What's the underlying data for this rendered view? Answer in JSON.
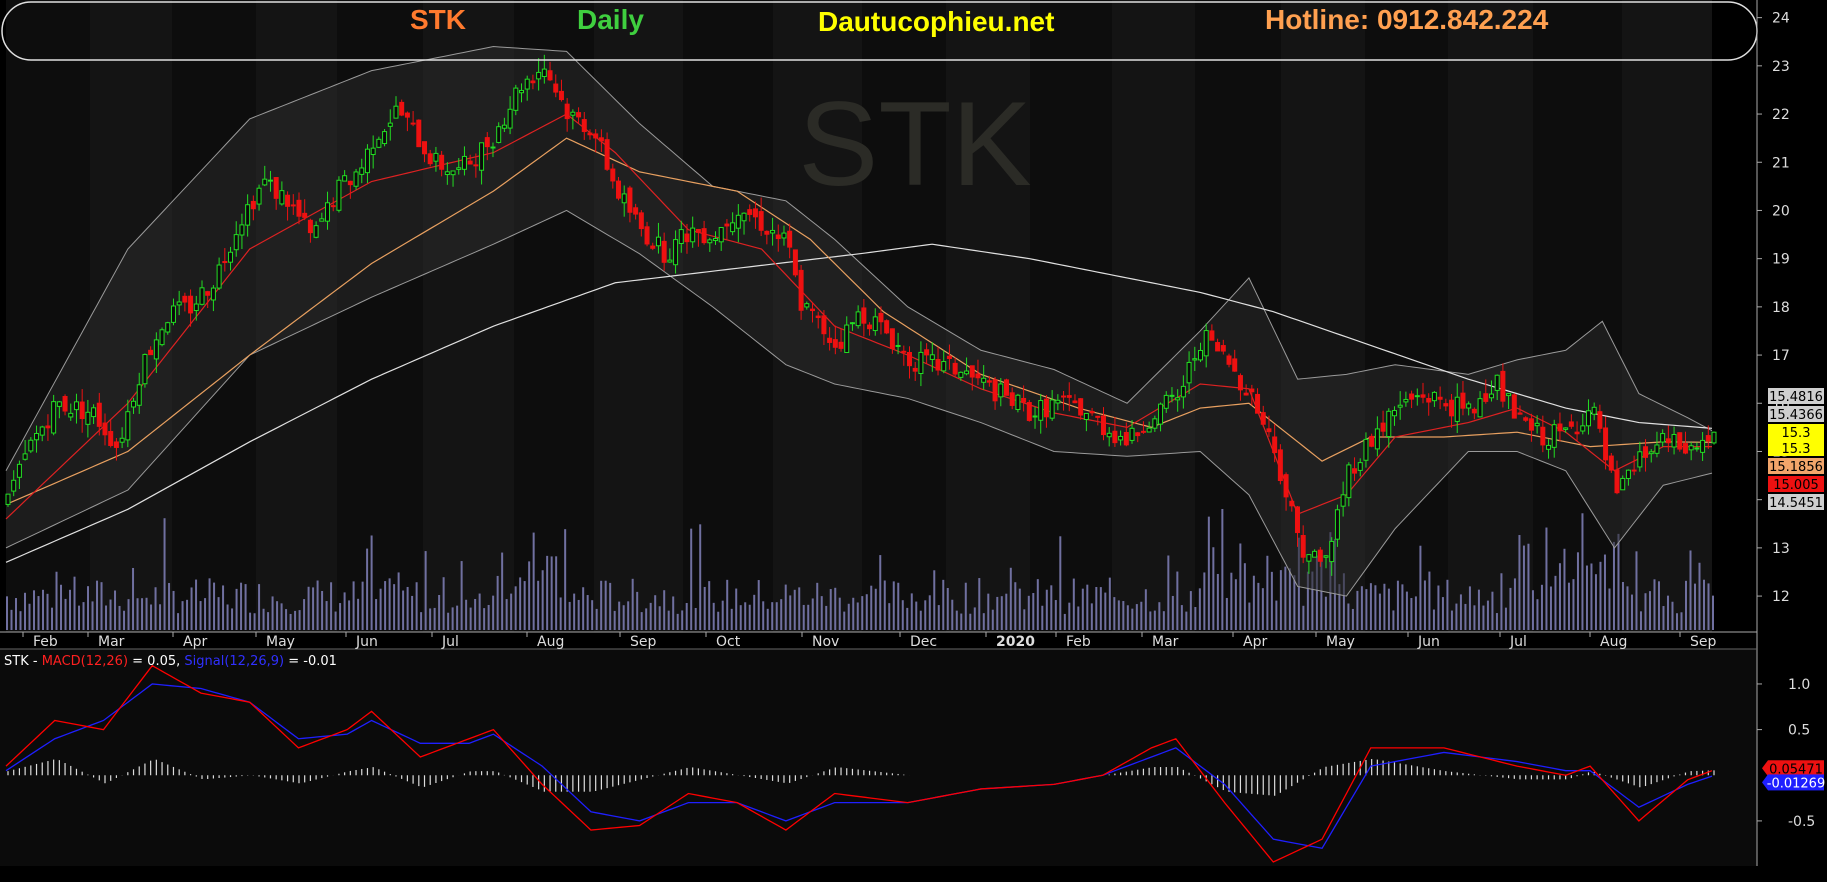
{
  "header": {
    "ticker": "STK",
    "period": "Daily",
    "site": "Dautucophieu.net",
    "hotline": "Hotline: 0912.842.224"
  },
  "watermark": "STK",
  "colors": {
    "ticker": "#ff7a2e",
    "period": "#3fcf3f",
    "site": "#ffff00",
    "hotline": "#ffa050",
    "up_candle": "#22dd22",
    "down_candle": "#ee1111",
    "ma_fast": "#dd2222",
    "ma_mid": "#e8a060",
    "ma_slow": "#e0e0e0",
    "bollinger": "#9a9a9a",
    "volume": "#7070a0",
    "macd": "#ff0000",
    "signal": "#1f1fff",
    "histogram": "#dddddd"
  },
  "chart_data": [
    {
      "type": "candlestick",
      "title": "STK Daily",
      "x_labels": [
        "Feb",
        "Mar",
        "Apr",
        "May",
        "Jun",
        "Jul",
        "Aug",
        "Sep",
        "Oct",
        "Nov",
        "Dec",
        "2020",
        "Feb",
        "Mar",
        "Apr",
        "May",
        "Jun",
        "Jul",
        "Aug",
        "Sep"
      ],
      "y_ticks": [
        12,
        13,
        14,
        15,
        16,
        17,
        18,
        19,
        20,
        21,
        22,
        23,
        24
      ],
      "ylim": [
        11.4,
        24.2
      ],
      "close_path": [
        [
          0,
          14.0
        ],
        [
          2,
          15.2
        ],
        [
          4,
          16.0
        ],
        [
          7,
          15.8
        ],
        [
          9,
          15.1
        ],
        [
          11,
          16.8
        ],
        [
          13,
          17.8
        ],
        [
          15,
          18.0
        ],
        [
          17,
          18.6
        ],
        [
          19,
          19.8
        ],
        [
          21,
          20.6
        ],
        [
          23,
          20.2
        ],
        [
          25,
          19.4
        ],
        [
          27,
          20.4
        ],
        [
          29,
          20.9
        ],
        [
          30,
          21.5
        ],
        [
          32,
          22.1
        ],
        [
          35,
          21.0
        ],
        [
          37,
          20.8
        ],
        [
          39,
          21.3
        ],
        [
          40,
          21.6
        ],
        [
          42,
          22.6
        ],
        [
          44,
          23.0
        ],
        [
          46,
          22.0
        ],
        [
          48,
          21.7
        ],
        [
          50,
          20.4
        ],
        [
          52,
          19.6
        ],
        [
          54,
          19.1
        ],
        [
          56,
          19.6
        ],
        [
          58,
          19.5
        ],
        [
          60,
          20.1
        ],
        [
          62,
          19.7
        ],
        [
          64,
          19.3
        ],
        [
          65,
          18.1
        ],
        [
          68,
          17.2
        ],
        [
          70,
          17.9
        ],
        [
          72,
          17.5
        ],
        [
          74,
          16.9
        ],
        [
          76,
          16.8
        ],
        [
          78,
          16.7
        ],
        [
          80,
          16.4
        ],
        [
          82,
          16.1
        ],
        [
          84,
          15.8
        ],
        [
          86,
          16.0
        ],
        [
          88,
          15.9
        ],
        [
          90,
          15.5
        ],
        [
          92,
          15.2
        ],
        [
          94,
          15.8
        ],
        [
          96,
          16.1
        ],
        [
          98,
          17.4
        ],
        [
          100,
          16.9
        ],
        [
          102,
          16.2
        ],
        [
          104,
          15.0
        ],
        [
          106,
          13.1
        ],
        [
          108,
          12.6
        ],
        [
          110,
          14.6
        ],
        [
          112,
          15.3
        ],
        [
          114,
          15.9
        ],
        [
          116,
          16.2
        ],
        [
          118,
          16.0
        ],
        [
          120,
          15.8
        ],
        [
          122,
          16.5
        ],
        [
          124,
          15.6
        ],
        [
          126,
          15.3
        ],
        [
          128,
          15.4
        ],
        [
          130,
          15.9
        ],
        [
          132,
          14.0
        ],
        [
          134,
          14.9
        ],
        [
          136,
          15.2
        ],
        [
          138,
          15.0
        ],
        [
          140,
          15.35
        ]
      ],
      "ma_fast": [
        [
          0,
          13.6
        ],
        [
          10,
          16.0
        ],
        [
          20,
          19.2
        ],
        [
          30,
          20.6
        ],
        [
          40,
          21.2
        ],
        [
          46,
          22.0
        ],
        [
          50,
          21.2
        ],
        [
          56,
          19.6
        ],
        [
          62,
          19.2
        ],
        [
          68,
          17.6
        ],
        [
          74,
          17.0
        ],
        [
          80,
          16.3
        ],
        [
          86,
          15.8
        ],
        [
          92,
          15.5
        ],
        [
          98,
          16.4
        ],
        [
          102,
          16.3
        ],
        [
          106,
          13.7
        ],
        [
          110,
          14.1
        ],
        [
          114,
          15.3
        ],
        [
          120,
          15.6
        ],
        [
          124,
          15.9
        ],
        [
          128,
          15.4
        ],
        [
          132,
          14.6
        ],
        [
          136,
          15.1
        ],
        [
          140,
          15.1
        ]
      ],
      "ma_mid": [
        [
          0,
          13.9
        ],
        [
          10,
          15.0
        ],
        [
          20,
          17.0
        ],
        [
          30,
          18.9
        ],
        [
          40,
          20.4
        ],
        [
          46,
          21.5
        ],
        [
          52,
          20.8
        ],
        [
          60,
          20.4
        ],
        [
          66,
          19.4
        ],
        [
          72,
          17.9
        ],
        [
          80,
          16.6
        ],
        [
          88,
          15.9
        ],
        [
          94,
          15.5
        ],
        [
          98,
          15.9
        ],
        [
          102,
          16.0
        ],
        [
          108,
          14.8
        ],
        [
          112,
          15.3
        ],
        [
          118,
          15.3
        ],
        [
          124,
          15.4
        ],
        [
          130,
          15.1
        ],
        [
          136,
          15.2
        ],
        [
          140,
          15.19
        ]
      ],
      "ma_slow": [
        [
          0,
          12.7
        ],
        [
          10,
          13.8
        ],
        [
          20,
          15.2
        ],
        [
          30,
          16.5
        ],
        [
          40,
          17.6
        ],
        [
          50,
          18.5
        ],
        [
          60,
          18.8
        ],
        [
          70,
          19.1
        ],
        [
          76,
          19.3
        ],
        [
          84,
          19.0
        ],
        [
          92,
          18.6
        ],
        [
          98,
          18.3
        ],
        [
          104,
          17.9
        ],
        [
          112,
          17.2
        ],
        [
          120,
          16.5
        ],
        [
          128,
          15.9
        ],
        [
          134,
          15.6
        ],
        [
          140,
          15.48
        ]
      ],
      "bb_upper": [
        [
          0,
          14.6
        ],
        [
          10,
          19.2
        ],
        [
          20,
          21.9
        ],
        [
          30,
          22.9
        ],
        [
          40,
          23.4
        ],
        [
          46,
          23.3
        ],
        [
          52,
          21.8
        ],
        [
          58,
          20.5
        ],
        [
          64,
          20.2
        ],
        [
          68,
          19.4
        ],
        [
          74,
          18.0
        ],
        [
          80,
          17.1
        ],
        [
          86,
          16.7
        ],
        [
          92,
          16.0
        ],
        [
          98,
          17.5
        ],
        [
          102,
          18.6
        ],
        [
          106,
          16.5
        ],
        [
          110,
          16.6
        ],
        [
          114,
          16.8
        ],
        [
          120,
          16.6
        ],
        [
          124,
          16.9
        ],
        [
          128,
          17.1
        ],
        [
          131,
          17.7
        ],
        [
          134,
          16.2
        ],
        [
          138,
          15.7
        ],
        [
          140,
          15.43
        ]
      ],
      "bb_lower": [
        [
          0,
          13.0
        ],
        [
          10,
          14.2
        ],
        [
          20,
          17.0
        ],
        [
          30,
          18.2
        ],
        [
          40,
          19.3
        ],
        [
          46,
          20.0
        ],
        [
          52,
          19.1
        ],
        [
          58,
          18.0
        ],
        [
          64,
          16.8
        ],
        [
          68,
          16.4
        ],
        [
          74,
          16.1
        ],
        [
          80,
          15.6
        ],
        [
          86,
          15.0
        ],
        [
          92,
          14.9
        ],
        [
          98,
          15.0
        ],
        [
          102,
          14.1
        ],
        [
          106,
          12.2
        ],
        [
          110,
          12.0
        ],
        [
          114,
          13.4
        ],
        [
          120,
          15.0
        ],
        [
          124,
          15.0
        ],
        [
          128,
          14.6
        ],
        [
          132,
          13.0
        ],
        [
          136,
          14.3
        ],
        [
          140,
          14.55
        ]
      ],
      "volume_max": 1.0,
      "price_badges": [
        {
          "label": "15.4816",
          "value": 15.4816,
          "bg": "#cfcfcf",
          "fg": "#000000"
        },
        {
          "label": "15.4366",
          "value": 15.4366,
          "bg": "#cfcfcf",
          "fg": "#000000"
        },
        {
          "label": "15.3",
          "value": 15.3,
          "bg": "#ffff00",
          "fg": "#000000"
        },
        {
          "label": "15.3",
          "value": 15.3,
          "bg": "#ffff00",
          "fg": "#000000"
        },
        {
          "label": "15.1856",
          "value": 15.1856,
          "bg": "#f2a56a",
          "fg": "#000000"
        },
        {
          "label": "15.005",
          "value": 15.005,
          "bg": "#ee1111",
          "fg": "#000000"
        },
        {
          "label": "14.5451",
          "value": 14.5451,
          "bg": "#cfcfcf",
          "fg": "#000000"
        }
      ]
    },
    {
      "type": "line",
      "title_parts": {
        "ticker": "STK -",
        "macd": "MACD(12,26)",
        "macd_value": "= 0.05,",
        "signal": "Signal(12,26,9)",
        "signal_value": "= -0.01"
      },
      "y_ticks": [
        1.0,
        0.5,
        -0.5
      ],
      "y_tick_labels": [
        "1.0",
        "0.5",
        "-0.5"
      ],
      "ylim": [
        -0.95,
        1.35
      ],
      "macd": [
        [
          0,
          0.1
        ],
        [
          4,
          0.6
        ],
        [
          8,
          0.5
        ],
        [
          12,
          1.2
        ],
        [
          16,
          0.9
        ],
        [
          20,
          0.8
        ],
        [
          24,
          0.3
        ],
        [
          28,
          0.5
        ],
        [
          30,
          0.7
        ],
        [
          34,
          0.2
        ],
        [
          38,
          0.4
        ],
        [
          40,
          0.5
        ],
        [
          44,
          -0.1
        ],
        [
          48,
          -0.6
        ],
        [
          52,
          -0.55
        ],
        [
          56,
          -0.2
        ],
        [
          60,
          -0.3
        ],
        [
          64,
          -0.6
        ],
        [
          68,
          -0.2
        ],
        [
          74,
          -0.3
        ],
        [
          80,
          -0.15
        ],
        [
          86,
          -0.1
        ],
        [
          90,
          0.0
        ],
        [
          94,
          0.3
        ],
        [
          96,
          0.4
        ],
        [
          100,
          -0.3
        ],
        [
          104,
          -0.95
        ],
        [
          108,
          -0.7
        ],
        [
          112,
          0.3
        ],
        [
          118,
          0.3
        ],
        [
          124,
          0.1
        ],
        [
          128,
          0.0
        ],
        [
          130,
          0.1
        ],
        [
          134,
          -0.5
        ],
        [
          138,
          -0.05
        ],
        [
          140,
          0.05
        ]
      ],
      "signal": [
        [
          0,
          0.05
        ],
        [
          4,
          0.4
        ],
        [
          8,
          0.6
        ],
        [
          12,
          1.0
        ],
        [
          16,
          0.95
        ],
        [
          20,
          0.8
        ],
        [
          24,
          0.4
        ],
        [
          28,
          0.45
        ],
        [
          30,
          0.6
        ],
        [
          34,
          0.35
        ],
        [
          38,
          0.35
        ],
        [
          40,
          0.45
        ],
        [
          44,
          0.1
        ],
        [
          48,
          -0.4
        ],
        [
          52,
          -0.5
        ],
        [
          56,
          -0.3
        ],
        [
          60,
          -0.3
        ],
        [
          64,
          -0.5
        ],
        [
          68,
          -0.3
        ],
        [
          74,
          -0.3
        ],
        [
          80,
          -0.15
        ],
        [
          86,
          -0.1
        ],
        [
          90,
          0.0
        ],
        [
          94,
          0.2
        ],
        [
          96,
          0.3
        ],
        [
          100,
          -0.1
        ],
        [
          104,
          -0.7
        ],
        [
          108,
          -0.8
        ],
        [
          112,
          0.1
        ],
        [
          118,
          0.25
        ],
        [
          124,
          0.15
        ],
        [
          128,
          0.05
        ],
        [
          130,
          0.05
        ],
        [
          134,
          -0.35
        ],
        [
          138,
          -0.1
        ],
        [
          140,
          -0.01
        ]
      ],
      "badges": [
        {
          "label": "0.05471",
          "value": 0.05471,
          "bg": "#ee1111",
          "fg": "#000000"
        },
        {
          "label": "-0.01269",
          "value": -0.01269,
          "bg": "#1f1fff",
          "fg": "#ffffff"
        }
      ]
    }
  ]
}
